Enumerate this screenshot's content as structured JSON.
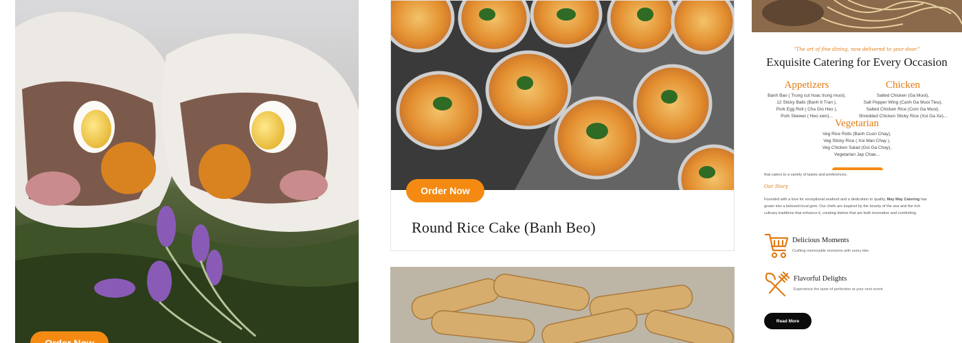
{
  "cards": [
    {
      "order_label": "Order Now"
    },
    {
      "order_label": "Order Now",
      "title": "Round Rice Cake (Banh Beo)"
    }
  ],
  "catering": {
    "tagline": "\"The art of fine dining, now delivered to your door.\"",
    "title": "Exquisite Catering for Every Occasion",
    "categories": [
      {
        "name": "Appetizers",
        "items": [
          "Banh Bao ( Trung cut hoac trung muoi),",
          "12 Sticky Balls (Banh It Tran ),",
          "Pork Egg Roll ( Cha Gio Heo ),",
          "Pork Skewer ( Heo xien)..."
        ]
      },
      {
        "name": "Chicken",
        "items": [
          "Salted Chicken (Ga Muoi),",
          "Salt Pepper Wing (Canh Ga Muoi Tieu),",
          "Salted Chicken Rice (Com Ga Muoi),",
          "Shredded Chicken Sticky Rice (Xoi Ga Xe)..."
        ]
      },
      {
        "name": "Vegetarian",
        "items": [
          "Veg Rice Rolls (Banh Cuon Chay),",
          "Veg Sticky Rice ( Xoi Man Chay ),",
          "Veg Chicken Salad (Goi Ga Chay),",
          "Vegetarian Jap Chae..."
        ]
      }
    ],
    "intro_tail": "that caters to a variety of tastes and preferences.",
    "story_heading": "Our Story",
    "story_lines": [
      {
        "before": "Founded with a love for exceptional seafood and a dedication to quality, ",
        "bold": "May May Catering",
        "after": " has"
      },
      {
        "before": "grown into a beloved local gem. Our chefs are inspired by the bounty of the sea and the rich",
        "bold": "",
        "after": ""
      },
      {
        "before": "culinary traditions that enhance it, creating dishes that are both innovative and comforting.",
        "bold": "",
        "after": ""
      }
    ],
    "features": [
      {
        "icon": "cart-icon",
        "title": "Delicious Moments",
        "desc": "Crafting memorable moments with every bite."
      },
      {
        "icon": "fork-spoon-icon",
        "title": "Flavorful Delights",
        "desc": "Experience the taste of perfection at your next event."
      }
    ],
    "read_more_label": "Read More"
  },
  "colors": {
    "accent": "#f58a13",
    "heading_orange": "#e07b14",
    "button_dark": "#0b0b0b"
  }
}
